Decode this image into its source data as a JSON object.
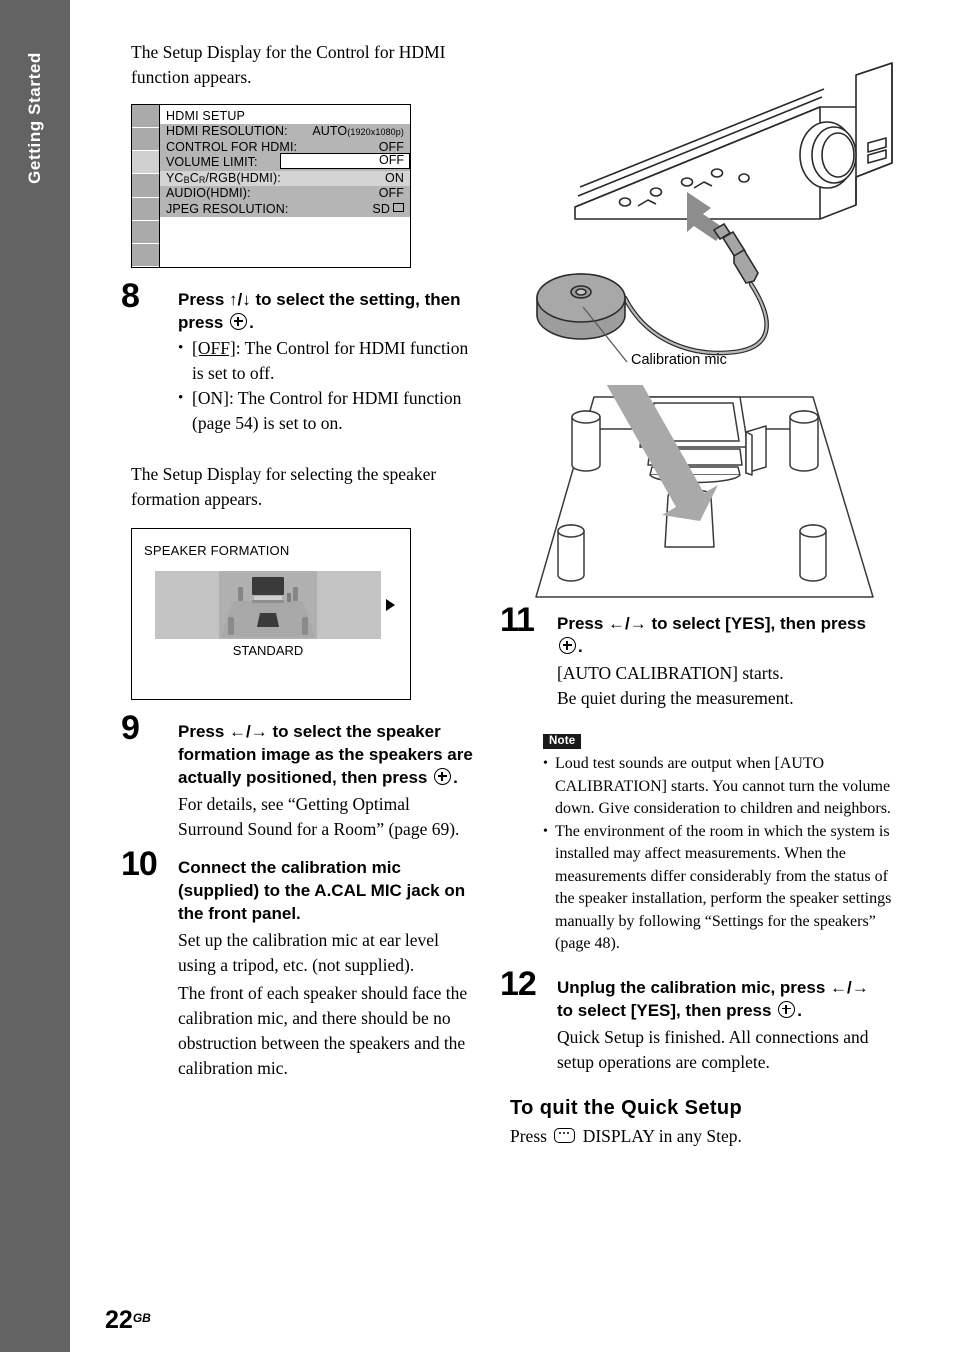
{
  "sidebar": {
    "tab_label": "Getting Started"
  },
  "page_footer": {
    "number": "22",
    "region": "GB"
  },
  "left_column": {
    "intro_1": "The Setup Display for the Control for HDMI function appears.",
    "osd_hdmi": {
      "title": "HDMI SETUP",
      "rows": [
        {
          "label": "HDMI RESOLUTION:",
          "value": "AUTO",
          "value_small": "(1920x1080p)",
          "state": "normal"
        },
        {
          "label": "CONTROL FOR HDMI:",
          "value": "OFF",
          "value_small": "",
          "state": "normal"
        },
        {
          "label": "VOLUME LIMIT:",
          "value": "OFF",
          "value_small": "",
          "state": "selected"
        },
        {
          "label": "YCBCR/RGB(HDMI):",
          "value": "ON",
          "value_small": "",
          "state": "highlight"
        },
        {
          "label": "AUDIO(HDMI):",
          "value": "OFF",
          "value_small": "",
          "state": "normal"
        },
        {
          "label": "JPEG RESOLUTION:",
          "value": "SD",
          "value_small": "",
          "state": "normal"
        }
      ],
      "tab_count": 7,
      "selected_tab_index": 2
    },
    "step8": {
      "number": "8",
      "heading_a": "Press ↑/↓ to select the setting, then",
      "heading_b": "press",
      "heading_end": ".",
      "bullets": [
        {
          "term": "[OFF]",
          "rest": ": The Control for HDMI function is set to off."
        },
        {
          "term": "[ON]",
          "rest": ": The Control for HDMI function (page 54) is set to on."
        }
      ]
    },
    "intro_2": "The Setup Display for selecting the speaker formation appears.",
    "osd_speaker": {
      "title": "SPEAKER FORMATION",
      "caption": "STANDARD",
      "next_arrow": "▶"
    },
    "step9": {
      "number": "9",
      "heading_a": "Press ←/→ to select the speaker",
      "heading_b": "formation image as the speakers are",
      "heading_c": "actually positioned, then press",
      "heading_end": ".",
      "body": "For details, see “Getting Optimal Surround Sound for a Room” (page 69)."
    },
    "step10": {
      "number": "10",
      "heading": "Connect the calibration mic (supplied) to the A.CAL MIC jack on the front panel.",
      "body_1": "Set up the calibration mic at ear level using a tripod, etc. (not supplied).",
      "body_2": "The front of each speaker should face the calibration mic, and there should be no obstruction between the speakers and the calibration mic."
    }
  },
  "right_column": {
    "illustration_label": "Calibration mic",
    "step11": {
      "number": "11",
      "heading_a": "Press ←/→ to select [YES], then press",
      "heading_end": ".",
      "body_1": "[AUTO CALIBRATION] starts.",
      "body_2": "Be quiet during the measurement."
    },
    "note": {
      "badge": "Note",
      "items": [
        "Loud test sounds are output when [AUTO CALIBRATION] starts. You cannot turn the volume down. Give consideration to children and neighbors.",
        "The environment of the room in which the system is installed may affect measurements. When the measurements differ considerably from the status of the speaker installation, perform the speaker settings manually by following “Settings for the speakers” (page 48)."
      ]
    },
    "step12": {
      "number": "12",
      "heading_a": "Unplug the calibration mic, press ←/→",
      "heading_b": "to select [YES], then press",
      "heading_end": ".",
      "body": "Quick Setup is finished. All connections and setup operations are complete."
    },
    "quit_section": {
      "heading": "To quit the Quick Setup",
      "body_pre": "Press",
      "body_post": "DISPLAY in any Step."
    }
  },
  "colors": {
    "sidebar_bg": "#636363",
    "osd_row_bg": "#b5b5b5",
    "osd_row_highlight": "#d4d4d4",
    "osd_tab_bg": "#aaaaaa",
    "osd_tab_selected": "#d0d0d0",
    "spk_image_bg": "#c3c3c3",
    "note_badge_bg": "#1a1a1a"
  }
}
